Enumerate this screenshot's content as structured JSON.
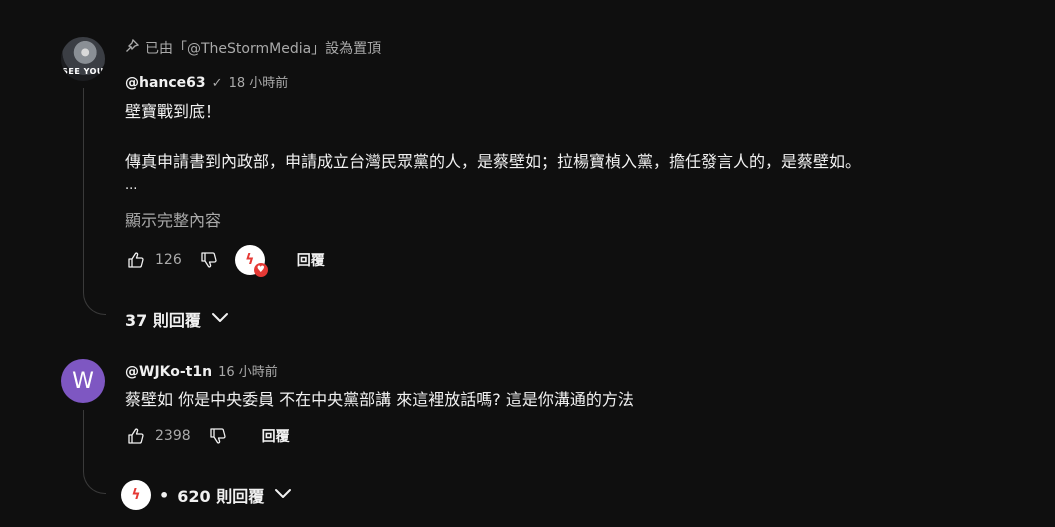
{
  "comments": [
    {
      "pinned_text": "已由「@TheStormMedia」設為置頂",
      "avatar_text": "SEE YOU",
      "author": "@hance63",
      "time": "18 小時前",
      "line1": "壁寶戰到底！",
      "line2": "傳真申請書到內政部，申請成立台灣民眾黨的人，是蔡壁如；拉楊寶楨入黨，擔任發言人的，是蔡壁如。",
      "ellipsis": "...",
      "show_more": "顯示完整內容",
      "likes": "126",
      "reply_label": "回覆",
      "replies_label": "37 則回覆"
    },
    {
      "avatar_letter": "W",
      "author": "@WJKo-t1n",
      "time": "16 小時前",
      "text": "蔡壁如 你是中央委員 不在中央黨部講 來這裡放話嗎? 這是你溝通的方法",
      "likes": "2398",
      "reply_label": "回覆",
      "replies_label": "620 則回覆"
    }
  ],
  "colors": {
    "background": "#0f0f0f",
    "text": "#f1f1f1",
    "muted": "#aaaaaa",
    "avatar_w": "#7e57c2",
    "heart": "#e53935"
  }
}
